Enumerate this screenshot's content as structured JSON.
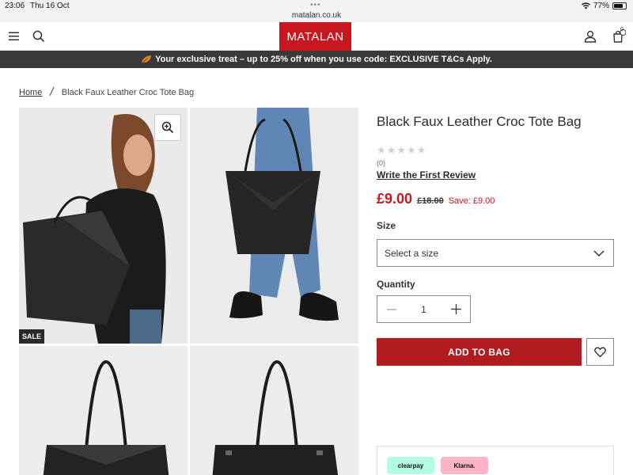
{
  "status_bar": {
    "time": "23:06",
    "date": "Thu 16 Oct",
    "url": "matalan.co.uk",
    "battery": "77%"
  },
  "header": {
    "logo": "MATALAN",
    "basket_count": "0"
  },
  "promo": {
    "text": "Your exclusive treat – up to 25% off when you use code: EXCLUSIVE T&Cs Apply."
  },
  "breadcrumb": {
    "home": "Home",
    "current": "Black Faux Leather Croc Tote Bag"
  },
  "gallery": {
    "sale_badge": "SALE"
  },
  "product": {
    "title": "Black Faux Leather Croc Tote Bag",
    "rating": 0,
    "review_count": "(0)",
    "review_link": "Write the First Review",
    "price_now": "£9.00",
    "price_was": "£18.00",
    "price_save": "Save: £9.00",
    "size_label": "Size",
    "size_placeholder": "Select a size",
    "quantity_label": "Quantity",
    "quantity_value": "1",
    "add_to_bag": "ADD TO BAG"
  },
  "payment": {
    "clearpay": "clearpay",
    "klarna": "Klarna."
  },
  "colors": {
    "brand_red": "#c8171e",
    "button_red": "#b01c1f",
    "promo_bg": "#3a3a3a"
  }
}
